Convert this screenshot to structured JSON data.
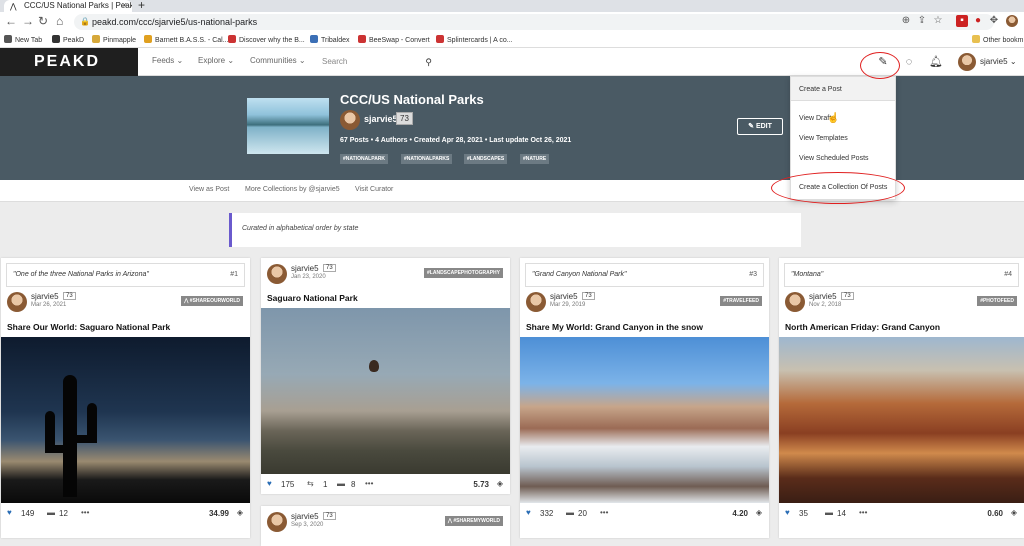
{
  "browser": {
    "tab_title": "CCC/US National Parks | PeakD",
    "url": "peakd.com/ccc/sjarvie5/us-national-parks",
    "bookmarks": [
      "New Tab",
      "PeakD",
      "Pinmapple",
      "Barnett B.A.S.S. - Cal...",
      "Discover why the B...",
      "Tribaldex",
      "BeeSwap - Convert",
      "Splintercards | A co..."
    ],
    "bookmarks_overflow": "Other bookm"
  },
  "nav": {
    "logo": "PEAKD",
    "feeds": "Feeds",
    "explore": "Explore",
    "communities": "Communities",
    "search_placeholder": "Search",
    "username": "sjarvie5"
  },
  "collection": {
    "title": "CCC/US National Parks",
    "author": "sjarvie5",
    "reputation": "73",
    "stats": "67 Posts  •  4 Authors  •  Created Apr 28, 2021  •  Last update Oct 26, 2021",
    "tags": [
      "#NATIONALPARK",
      "#NATIONALPARKS",
      "#LANDSCAPES",
      "#NATURE"
    ],
    "edit_label": "EDIT",
    "description": "Curated in alphabetical order by state"
  },
  "subnav": {
    "view_as_post": "View as Post",
    "more_collections": "More Collections by @sjarvie5",
    "visit_curator": "Visit Curator"
  },
  "create_menu": {
    "items": [
      "Create a Post",
      "View Drafts",
      "View Templates",
      "View Scheduled Posts",
      "Create a Collection Of Posts"
    ]
  },
  "cards": [
    {
      "quote": "\"One of the three National Parks in Arizona\"",
      "num": "#1",
      "author": "sjarvie5",
      "rep": "73",
      "date": "Mar 26, 2021",
      "tag": "#SHAREOURWORLD",
      "title": "Share Our World: Saguaro National Park",
      "upvotes": "149",
      "comments": "12",
      "payout": "34.99"
    },
    {
      "quote": "",
      "num": "",
      "author": "sjarvie5",
      "rep": "73",
      "date": "Jan 23, 2020",
      "tag": "#LANDSCAPEPHOTOGRAPHY",
      "title": "Saguaro National Park",
      "upvotes": "175",
      "reblogs": "1",
      "comments": "8",
      "payout": "5.73"
    },
    {
      "quote": "\"Grand Canyon National Park\"",
      "num": "#3",
      "author": "sjarvie5",
      "rep": "73",
      "date": "Mar 29, 2019",
      "tag": "#TRAVELFEED",
      "title": "Share My World: Grand Canyon in the snow",
      "upvotes": "332",
      "comments": "20",
      "payout": "4.20"
    },
    {
      "quote": "\"Montana\"",
      "num": "#4",
      "author": "sjarvie5",
      "rep": "73",
      "date": "Nov 2, 2018",
      "tag": "#PHOTOFEED",
      "title": "North American Friday: Grand Canyon",
      "upvotes": "35",
      "comments": "14",
      "payout": "0.60"
    }
  ],
  "next_card": {
    "author": "sjarvie5",
    "rep": "73",
    "date": "Sep 3, 2020",
    "tag": "#SHAREMYWORLD"
  }
}
